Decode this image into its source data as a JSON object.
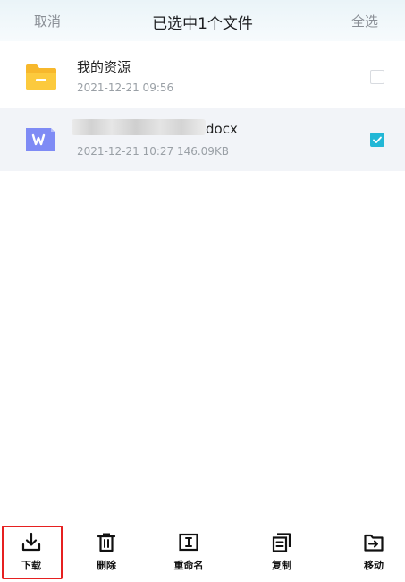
{
  "header": {
    "cancel_label": "取消",
    "title": "已选中1个文件",
    "select_all_label": "全选"
  },
  "files": [
    {
      "name": "我的资源",
      "meta": "2021-12-21  09:56",
      "icon": "folder-icon",
      "checked": false
    },
    {
      "name": "docx",
      "meta": "2021-12-21  10:27  146.09KB",
      "icon": "word-doc-icon",
      "checked": true
    }
  ],
  "toolbar": {
    "download_label": "下载",
    "delete_label": "删除",
    "rename_label": "重命名",
    "copy_label": "复制",
    "move_label": "移动"
  },
  "colors": {
    "accent": "#23b7d6",
    "folder": "#f7b82c",
    "doc_icon": "#7f8bf5",
    "highlight": "#e62020"
  }
}
